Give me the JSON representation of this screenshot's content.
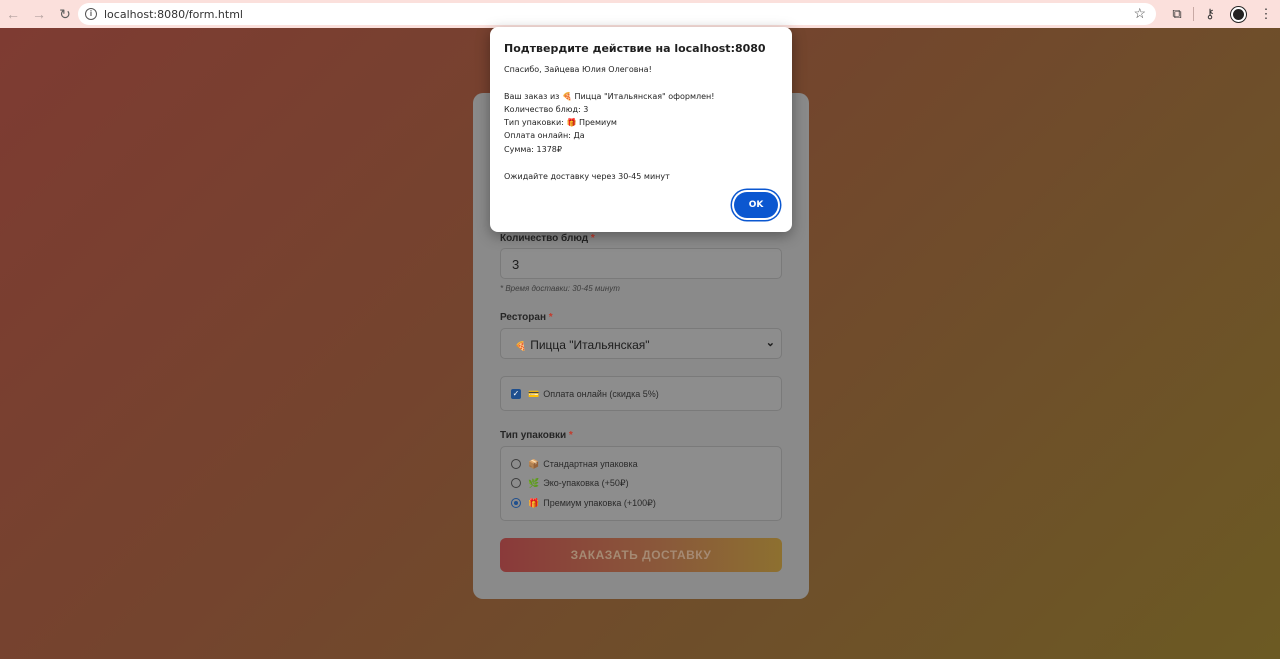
{
  "browser": {
    "url": "localhost:8080/form.html",
    "back_icon": "arrow-left",
    "forward_icon": "arrow-right",
    "reload_icon": "reload"
  },
  "form": {
    "quantity_label": "Количество блюд",
    "quantity_value": "3",
    "delivery_hint": "* Время доставки: 30-45 минут",
    "restaurant_label": "Ресторан",
    "restaurant_emoji": "🍕",
    "restaurant_value": "Пицца \"Итальянская\"",
    "online_payment_emoji": "💳",
    "online_payment_label": "Оплата онлайн (скидка 5%)",
    "online_payment_checked": true,
    "packaging_label": "Тип упаковки",
    "required_mark": "*",
    "packaging_options": [
      {
        "emoji": "📦",
        "label": "Стандартная упаковка",
        "checked": false
      },
      {
        "emoji": "🌿",
        "label": "Эко-упаковка (+50₽)",
        "checked": false
      },
      {
        "emoji": "🎁",
        "label": "Премиум упаковка (+100₽)",
        "checked": true
      }
    ],
    "submit_label": "ЗАКАЗАТЬ ДОСТАВКУ"
  },
  "dialog": {
    "title": "Подтвердите действие на localhost:8080",
    "lines": [
      "Спасибо, Зайцева Юлия Олеговна!",
      "",
      "Ваш заказ из 🍕 Пицца \"Итальянская\" оформлен!",
      "Количество блюд: 3",
      "Тип упаковки: 🎁 Премиум",
      "Оплата онлайн: Да",
      "Сумма: 1378₽",
      "",
      "Ожидайте доставку через 30-45 минут"
    ],
    "ok_label": "OK"
  },
  "colors": {
    "accent": "#0b57d0",
    "chrome_bg": "#fbe0dc"
  }
}
